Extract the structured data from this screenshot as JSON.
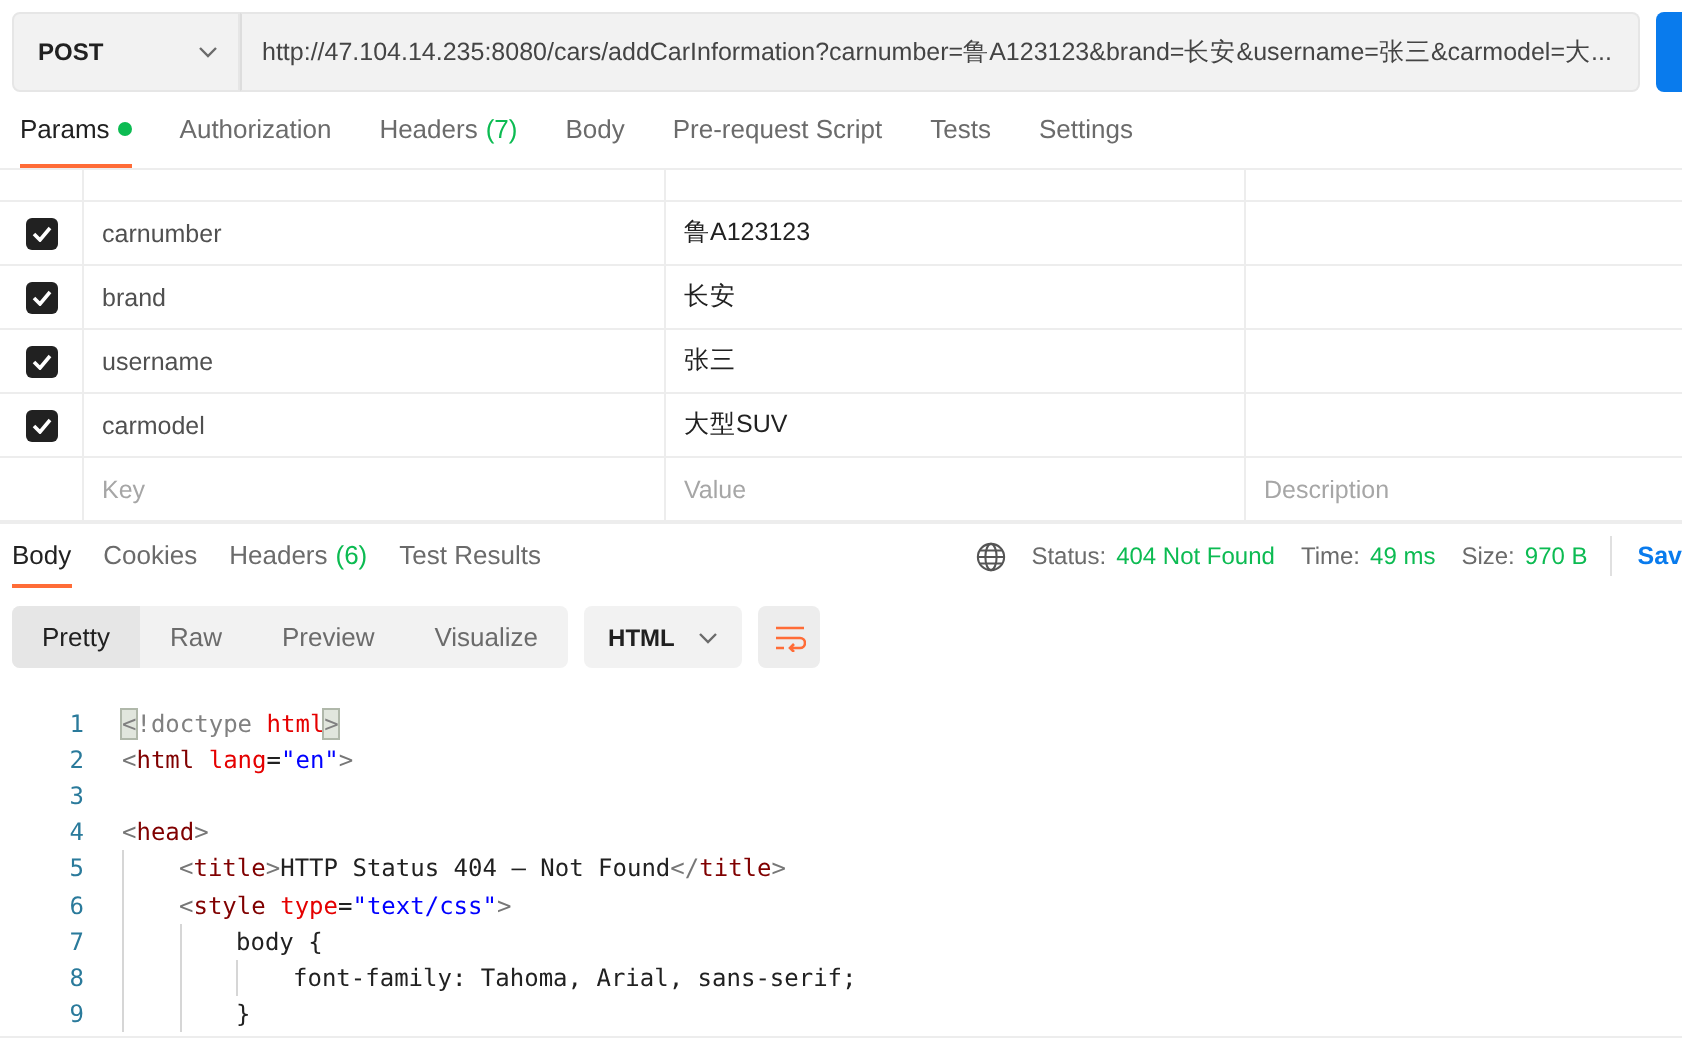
{
  "request": {
    "method": "POST",
    "url": "http://47.104.14.235:8080/cars/addCarInformation?carnumber=鲁A123123&brand=长安&username=张三&carmodel=大..."
  },
  "request_tabs": [
    {
      "label": "Params",
      "selected": true,
      "dot": true
    },
    {
      "label": "Authorization",
      "selected": false
    },
    {
      "label": "Headers",
      "count": "(7)",
      "selected": false
    },
    {
      "label": "Body",
      "selected": false
    },
    {
      "label": "Pre-request Script",
      "selected": false
    },
    {
      "label": "Tests",
      "selected": false
    },
    {
      "label": "Settings",
      "selected": false
    }
  ],
  "params": {
    "rows": [
      {
        "checked": true,
        "key": "carnumber",
        "value": "鲁A123123"
      },
      {
        "checked": true,
        "key": "brand",
        "value": "长安"
      },
      {
        "checked": true,
        "key": "username",
        "value": "张三"
      },
      {
        "checked": true,
        "key": "carmodel",
        "value": "大型SUV"
      }
    ],
    "new_row": {
      "key_placeholder": "Key",
      "value_placeholder": "Value",
      "description_placeholder": "Description"
    }
  },
  "response_tabs": [
    {
      "label": "Body",
      "selected": true
    },
    {
      "label": "Cookies",
      "selected": false
    },
    {
      "label": "Headers",
      "count": "(6)",
      "selected": false
    },
    {
      "label": "Test Results",
      "selected": false
    }
  ],
  "response_status": {
    "status_label": "Status:",
    "status": "404 Not Found",
    "time_label": "Time:",
    "time": "49 ms",
    "size_label": "Size:",
    "size": "970 B",
    "save": "Sav"
  },
  "view_modes": [
    {
      "label": "Pretty",
      "selected": true
    },
    {
      "label": "Raw",
      "selected": false
    },
    {
      "label": "Preview",
      "selected": false
    },
    {
      "label": "Visualize",
      "selected": false
    }
  ],
  "format": "HTML",
  "code_lines": [
    {
      "number": "1",
      "tokens": [
        {
          "kind": "match",
          "text": "<"
        },
        {
          "kind": "doctype",
          "text": "!doctype "
        },
        {
          "kind": "attr",
          "text": "html"
        },
        {
          "kind": "match",
          "text": ">"
        }
      ]
    },
    {
      "number": "2",
      "tokens": [
        {
          "kind": "punct",
          "text": "<"
        },
        {
          "kind": "tag",
          "text": "html "
        },
        {
          "kind": "attr",
          "text": "lang"
        },
        {
          "kind": "plain",
          "text": "="
        },
        {
          "kind": "string",
          "text": "\"en\""
        },
        {
          "kind": "punct",
          "text": ">"
        }
      ]
    },
    {
      "number": "3"
    },
    {
      "number": "4",
      "tokens": [
        {
          "kind": "punct",
          "text": "<"
        },
        {
          "kind": "tag",
          "text": "head"
        },
        {
          "kind": "punct",
          "text": ">"
        }
      ],
      "children": [
        {
          "number": "5",
          "tokens": [
            {
              "kind": "punct",
              "text": "<"
            },
            {
              "kind": "tag",
              "text": "title"
            },
            {
              "kind": "punct",
              "text": ">"
            },
            {
              "kind": "plain",
              "text": "HTTP Status 404 – Not Found"
            },
            {
              "kind": "punct",
              "text": "</"
            },
            {
              "kind": "tag",
              "text": "title"
            },
            {
              "kind": "punct",
              "text": ">"
            }
          ]
        },
        {
          "number": "6",
          "tokens": [
            {
              "kind": "punct",
              "text": "<"
            },
            {
              "kind": "tag",
              "text": "style "
            },
            {
              "kind": "attr",
              "text": "type"
            },
            {
              "kind": "plain",
              "text": "="
            },
            {
              "kind": "string",
              "text": "\"text/css\""
            },
            {
              "kind": "punct",
              "text": ">"
            }
          ],
          "children": [
            {
              "number": "7",
              "tokens": [
                {
                  "kind": "plain",
                  "text": "body {"
                }
              ],
              "children": [
                {
                  "number": "8",
                  "tokens": [
                    {
                      "kind": "plain",
                      "text": "font-family: Tahoma, Arial, sans-serif;"
                    }
                  ]
                }
              ]
            },
            {
              "number": "9",
              "tokens": [
                {
                  "kind": "plain",
                  "text": "}"
                }
              ]
            }
          ]
        }
      ]
    }
  ]
}
